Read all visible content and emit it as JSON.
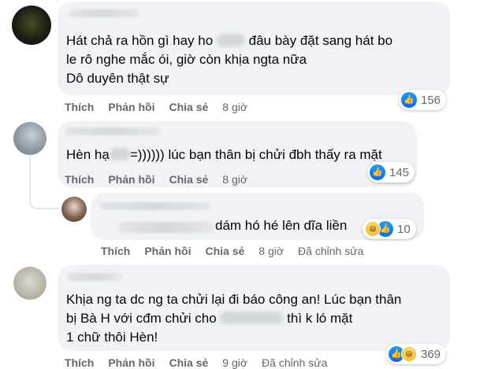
{
  "comments": [
    {
      "text_lines": [
        {
          "before": "Hát chả ra hồn gì hay ho ",
          "after": " đâu bày đặt sang hát bo"
        },
        {
          "before": "le rô nghe mắc ói, giờ còn khịa ngta nữa",
          "after": ""
        },
        {
          "before": "Dô duyên thật sự",
          "after": ""
        }
      ],
      "reaction_count": "156",
      "actions": {
        "like": "Thích",
        "reply": "Phản hồi",
        "share": "Chia sẻ",
        "time": "8 giờ"
      }
    },
    {
      "text_lines": [
        {
          "before": "Hèn hạ",
          "after": "=)))))) lúc bạn thân bị chửi đbh thấy ra mặt"
        }
      ],
      "reaction_count": "145",
      "actions": {
        "like": "Thích",
        "reply": "Phản hồi",
        "share": "Chia sẻ",
        "time": "8 giờ"
      }
    },
    {
      "text_lines": [
        {
          "before": "dám hó hé lên dĩa liền",
          "after": ""
        }
      ],
      "reaction_count": "10",
      "actions": {
        "like": "Thích",
        "reply": "Phản hồi",
        "share": "Chia sẻ",
        "time": "8 giờ",
        "edited": "Đã chỉnh sửa"
      }
    },
    {
      "text_lines": [
        {
          "before": "Khịa ng ta dc ng ta chửi lại đi báo công an! Lúc bạn thân",
          "after": ""
        },
        {
          "before": "bị Bà H với cđm chửi cho ",
          "after": " thì k ló mặt"
        },
        {
          "before": "1 chữ thôi Hèn!",
          "after": ""
        }
      ],
      "reaction_count": "369",
      "actions": {
        "like": "Thích",
        "reply": "Phản hồi",
        "share": "Chia sẻ",
        "time": "9 giờ",
        "edited": "Đã chỉnh sửa"
      }
    }
  ],
  "icons": {
    "like": "like-icon",
    "haha": "haha-icon"
  },
  "colors": {
    "bubble": "#f0f2f5",
    "meta_text": "#65676b",
    "like_blue": "#0866ff"
  }
}
